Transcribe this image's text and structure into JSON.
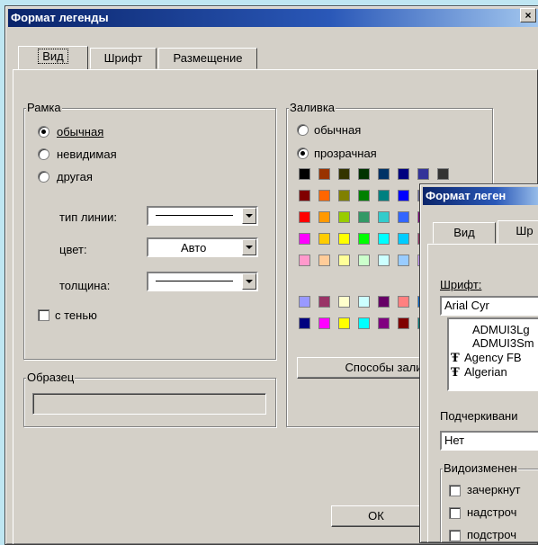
{
  "dialog1": {
    "title": "Формат легенды",
    "close": "×",
    "tabs": [
      "Вид",
      "Шрифт",
      "Размещение"
    ],
    "frame": {
      "legend": "Рамка",
      "options": [
        "обычная",
        "невидимая",
        "другая"
      ],
      "selected": 0,
      "line_type_label": "тип линии:",
      "color_label": "цвет:",
      "color_value": "Авто",
      "weight_label": "толщина:",
      "shadow_label": "с тенью"
    },
    "fill": {
      "legend": "Заливка",
      "options": [
        "обычная",
        "прозрачная"
      ],
      "selected": 1,
      "fill_methods_button": "Способы залив"
    },
    "sample": {
      "legend": "Образец"
    },
    "ok_button": "ОК",
    "palette_top": [
      [
        "#000000",
        "#993300",
        "#333300",
        "#003300",
        "#003366",
        "#000080",
        "#333399",
        "#333333"
      ],
      [
        "#800000",
        "#ff6600",
        "#808000",
        "#008000",
        "#008080",
        "#0000ff",
        "#666699",
        "#808080"
      ],
      [
        "#ff0000",
        "#ff9900",
        "#99cc00",
        "#339966",
        "#33cccc",
        "#3366ff",
        "#800080",
        "#969696"
      ],
      [
        "#ff00ff",
        "#ffcc00",
        "#ffff00",
        "#00ff00",
        "#00ffff",
        "#00ccff",
        "#993366",
        "#c0c0c0"
      ],
      [
        "#ff99cc",
        "#ffcc99",
        "#ffff99",
        "#ccffcc",
        "#ccffff",
        "#99ccff",
        "#cc99ff",
        "#ffffff"
      ]
    ],
    "palette_bottom": [
      [
        "#9999ff",
        "#993366",
        "#ffffcc",
        "#ccffff",
        "#660066",
        "#ff8080",
        "#0066cc",
        "#ccccff"
      ],
      [
        "#000080",
        "#ff00ff",
        "#ffff00",
        "#00ffff",
        "#800080",
        "#800000",
        "#008080",
        "#0000ff"
      ]
    ]
  },
  "dialog2": {
    "title": "Формат леген",
    "tabs": [
      "Вид",
      "Шр"
    ],
    "font_label": "Шрифт:",
    "font_value": "Arial Cyr",
    "font_list": [
      "ADMUI3Lg",
      "ADMUI3Sm",
      "Agency FB",
      "Algerian"
    ],
    "underline_label": "Подчеркивани",
    "underline_value": "Нет",
    "effects_legend": "Видоизменен",
    "effects": [
      "зачеркнут",
      "надстроч",
      "подстроч"
    ]
  }
}
